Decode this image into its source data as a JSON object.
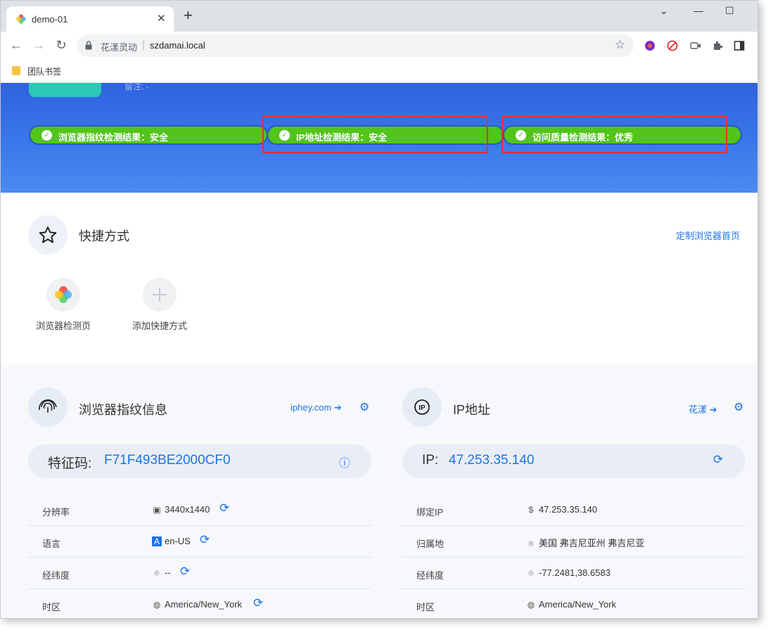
{
  "browser": {
    "tab_title": "demo-01",
    "site_name": "花漾灵动",
    "url": "szdamai.local",
    "bookmark_folder": "团队书签"
  },
  "banner": {
    "faint_text": "留注: -",
    "checks": [
      {
        "label": "浏览器指纹检测结果：安全"
      },
      {
        "label": "IP地址检测结果：安全"
      },
      {
        "label": "访问质量检测结果：优秀"
      }
    ]
  },
  "shortcuts": {
    "title": "快捷方式",
    "customize_link": "定制浏览器首页",
    "items": [
      {
        "label": "浏览器检测页"
      },
      {
        "label": "添加快捷方式"
      }
    ]
  },
  "fingerprint": {
    "title": "浏览器指纹信息",
    "link": "iphey.com",
    "code_label": "特征码:",
    "code_value": "F71F493BE2000CF0",
    "rows": [
      {
        "label": "分辨率",
        "value": "3440x1440",
        "icon": "monitor-icon"
      },
      {
        "label": "语言",
        "value": "en-US",
        "icon": "translate-icon"
      },
      {
        "label": "经纬度",
        "value": "--",
        "icon": "location-pin-icon"
      },
      {
        "label": "时区",
        "value": "America/New_York",
        "icon": "globe-icon"
      }
    ]
  },
  "ip": {
    "title": "IP地址",
    "link": "花漾",
    "code_label": "IP:",
    "code_value": "47.253.35.140",
    "rows": [
      {
        "label": "绑定IP",
        "value": "47.253.35.140",
        "icon": "dollar-circle-icon"
      },
      {
        "label": "归属地",
        "value": "美国 弗吉尼亚州 弗吉尼亚",
        "icon": "location-pin-icon"
      },
      {
        "label": "经纬度",
        "value": "-77.2481,38.6583",
        "icon": "location-pin-icon"
      },
      {
        "label": "时区",
        "value": "America/New_York",
        "icon": "globe-icon"
      }
    ]
  },
  "colors": {
    "accent": "#1e73e6",
    "success": "#52c41a",
    "banner": "#3a78ea",
    "highlight": "#e0303a"
  }
}
